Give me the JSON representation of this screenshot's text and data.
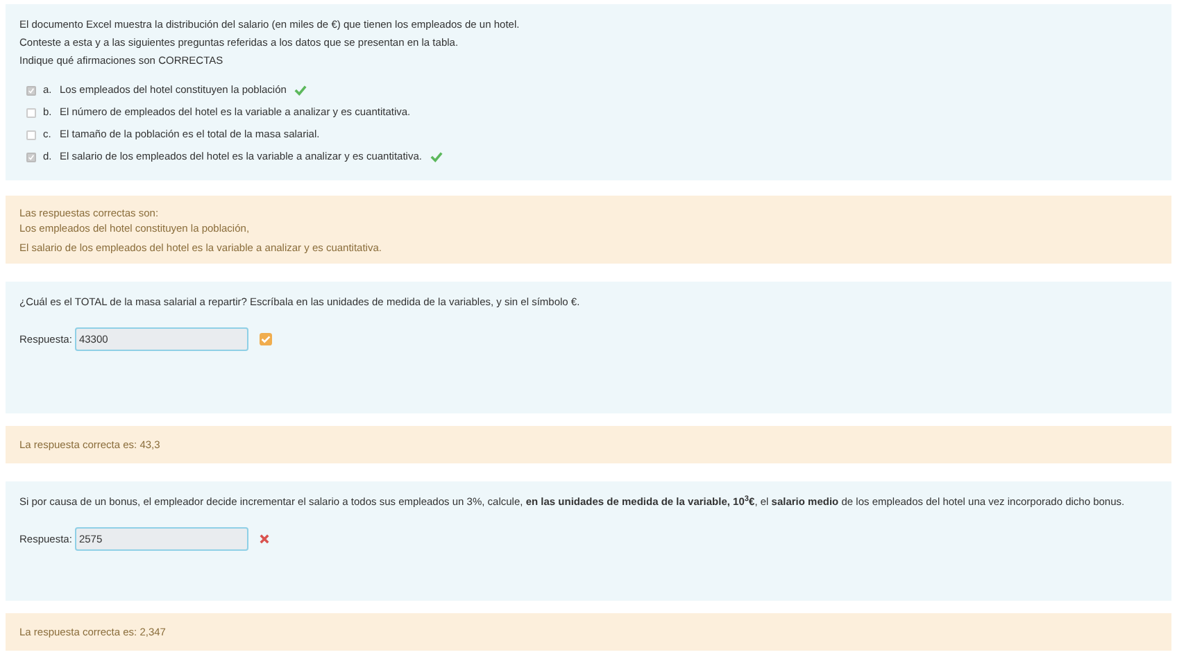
{
  "question_1": {
    "lines": [
      "El documento Excel muestra la distribución del salario (en miles de €) que tienen los empleados de un hotel.",
      "Conteste a esta y a las siguientes preguntas referidas a los datos que se presentan en la tabla.",
      "Indique qué afirmaciones son CORRECTAS"
    ],
    "options": [
      {
        "letter": "a.",
        "text": "Los empleados del hotel constituyen la población",
        "checked": true,
        "correct": true
      },
      {
        "letter": "b.",
        "text": "El número de empleados del hotel es la variable a analizar y es cuantitativa.",
        "checked": false,
        "correct": false
      },
      {
        "letter": "c.",
        "text": "El tamaño de la población es el total de la masa salarial.",
        "checked": false,
        "correct": false
      },
      {
        "letter": "d.",
        "text": "El salario de los empleados del hotel es la variable a analizar y es cuantitativa.",
        "checked": true,
        "correct": true
      }
    ],
    "feedback": [
      "Las respuestas correctas son:",
      "Los empleados del hotel constituyen la población,",
      "El salario de los empleados del hotel es la variable a analizar y es cuantitativa."
    ]
  },
  "questions": [
    {
      "text": "¿Cuál es el TOTAL de la masa salarial a repartir? Escríbala en las unidades de medida de la variables, y sin el símbolo €.",
      "label": "Respuesta:",
      "value": "43300",
      "kind": "partial",
      "feedback": "La respuesta correcta es: 43,3"
    },
    {
      "text": "Si por causa de un bonus, el empleador decide incrementar el salario a todos sus empleados un 3%, calcule, **en las unidades de medida de la variable, 10$^{3}$€**, el **salario medio** de los empleados del hotel una vez incorporado dicho bonus.",
      "label": "Respuesta:",
      "value": "2575",
      "kind": "incorrect",
      "feedback": "La respuesta correcta es: 2,347"
    }
  ]
}
